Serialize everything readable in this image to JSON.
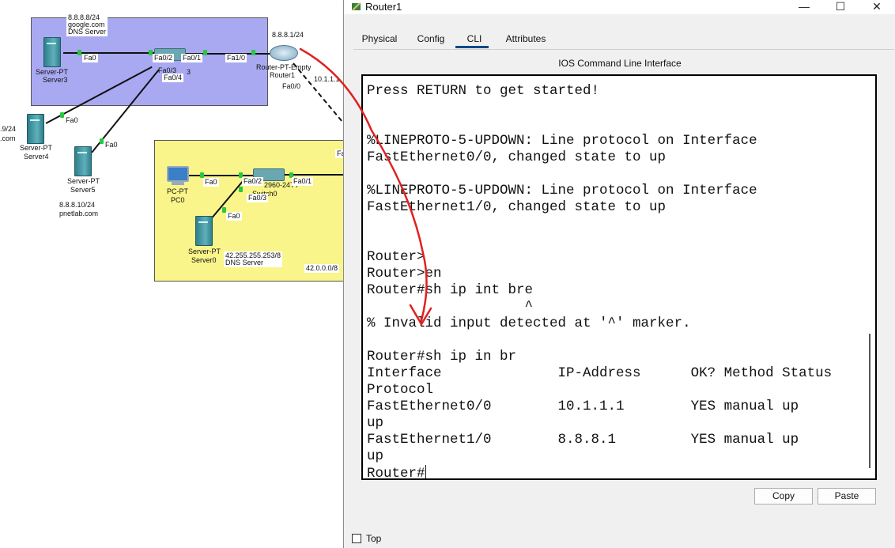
{
  "topology": {
    "top_area": {
      "dns_ip": "8.8.8.8/24",
      "dns_domain": "google.com",
      "dns_role": "DNS Server",
      "server3_type": "Server-PT",
      "server3_name": "Server3",
      "server3_port": "Fa0",
      "switch_ports": [
        "Fa0/2",
        "Fa0/1",
        "Fa0/3",
        "Fa0/4"
      ],
      "switch_suffix": "3",
      "router_link_port": "Fa1/0",
      "router_ip": "8.8.8.1/24",
      "router_type": "Router-PT-Empty",
      "router_name": "Router1",
      "router_port_fa00": "Fa0/0",
      "router_link_ip": "10.1.1.1"
    },
    "left": {
      "server4_ip_partial": ".9/24",
      "server4_domain_partial": ".com",
      "server4_type": "Server-PT",
      "server4_name": "Server4",
      "server4_port": "Fa0",
      "server5_type": "Server-PT",
      "server5_name": "Server5",
      "server5_port": "Fa0",
      "server5_ip": "8.8.8.10/24",
      "server5_domain": "pnetlab.com"
    },
    "bottom_area": {
      "pc_type": "PC-PT",
      "pc_name": "PC0",
      "pc_port": "Fa0",
      "switch_model": "2960-24TT",
      "switch_name": "Switch0",
      "switch_ports": [
        "Fa0/2",
        "Fa0/1",
        "Fa0/3"
      ],
      "server0_port": "Fa0",
      "server0_type": "Server-PT",
      "server0_name": "Server0",
      "server0_ip": "42.255.255.253/8",
      "server0_role": "DNS Server",
      "network": "42.0.0.0/8",
      "edge_port_partial": "Fa"
    }
  },
  "dialog": {
    "title": "Router1",
    "window_controls": {
      "minimize": "—",
      "maximize": "☐",
      "close": "✕"
    },
    "tabs": [
      "Physical",
      "Config",
      "CLI",
      "Attributes"
    ],
    "active_tab": "CLI",
    "heading": "IOS Command Line Interface",
    "terminal_lines": [
      "Press RETURN to get started!",
      "",
      "",
      "%LINEPROTO-5-UPDOWN: Line protocol on Interface",
      "FastEthernet0/0, changed state to up",
      "",
      "%LINEPROTO-5-UPDOWN: Line protocol on Interface",
      "FastEthernet1/0, changed state to up",
      "",
      "",
      "Router>",
      "Router>en",
      "Router#sh ip int bre",
      "                   ^",
      "% Invalid input detected at '^' marker.",
      "",
      "Router#sh ip in br",
      "Interface              IP-Address      OK? Method Status",
      "Protocol",
      "FastEthernet0/0        10.1.1.1        YES manual up",
      "up",
      "FastEthernet1/0        8.8.8.1         YES manual up",
      "up",
      "Router#"
    ],
    "buttons": {
      "copy": "Copy",
      "paste": "Paste"
    },
    "top_checkbox": {
      "label": "Top",
      "checked": false
    }
  },
  "colors": {
    "top_area": "#a9a9f2",
    "bottom_area": "#f9f58a",
    "link_port_indicator": "#27c93f",
    "annotation_arrow": "#e02020",
    "tab_underline": "#0b4a87"
  }
}
